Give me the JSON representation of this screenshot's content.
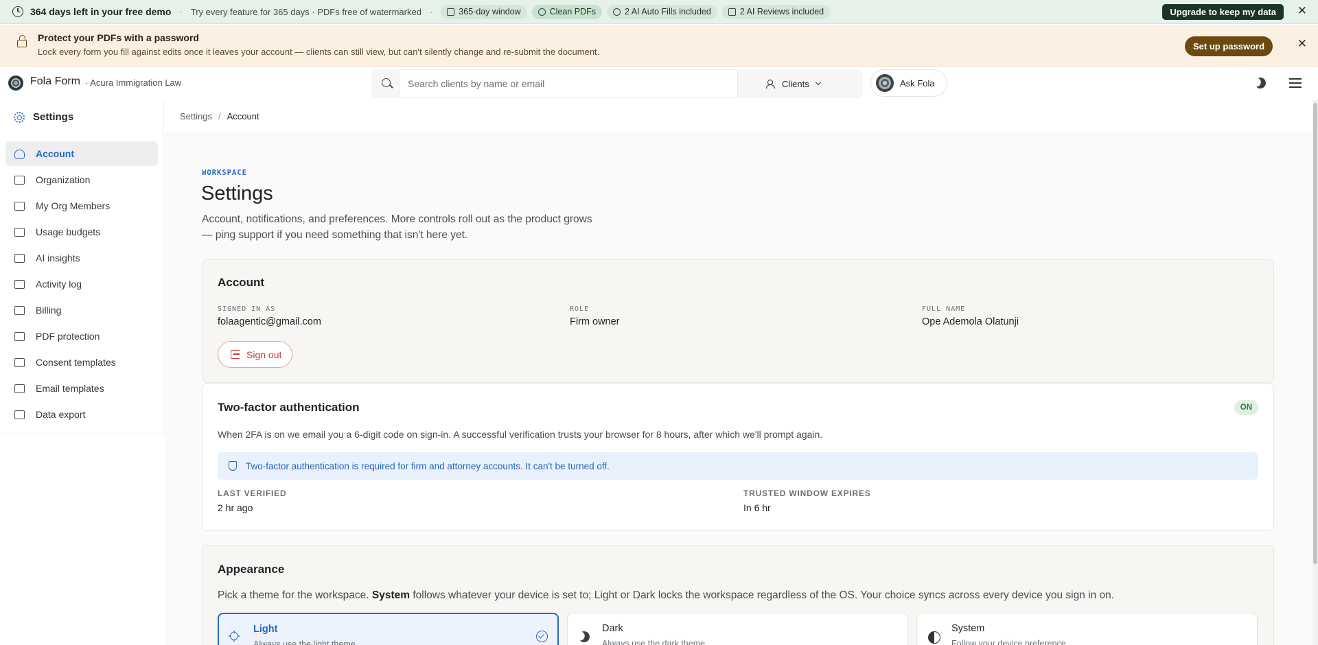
{
  "demo_bar": {
    "title": "364 days left in your free demo",
    "subtitle": "Try every feature for 365 days · PDFs free of watermarked",
    "pills": [
      {
        "label": "365-day window",
        "icon": "calendar-icon"
      },
      {
        "label": "Clean PDFs",
        "icon": "check-circle-icon"
      },
      {
        "label": "2 AI Auto Fills included",
        "icon": "sparkle-icon"
      },
      {
        "label": "2 AI Reviews included",
        "icon": "review-icon"
      }
    ],
    "upgrade_label": "Upgrade to keep my data",
    "close_label": "✕"
  },
  "password_banner": {
    "title": "Protect your PDFs with a password",
    "text": "Lock every form you fill against edits once it leaves your account — clients can still view, but can't silently change and re-submit the document.",
    "button_label": "Set up password",
    "close_label": "✕"
  },
  "header": {
    "brand": "Fola Form",
    "org": "· Acura Immigration Law",
    "search_placeholder": "Search clients by name or email",
    "clients_label": "Clients",
    "ask_label": "Ask Fola"
  },
  "sidebar": {
    "heading": "Settings",
    "items": [
      {
        "label": "Account",
        "icon": "user-icon",
        "active": true
      },
      {
        "label": "Organization",
        "icon": "building-icon"
      },
      {
        "label": "My Org Members",
        "icon": "members-icon"
      },
      {
        "label": "Usage budgets",
        "icon": "sliders-icon"
      },
      {
        "label": "AI insights",
        "icon": "trend-icon"
      },
      {
        "label": "Activity log",
        "icon": "history-icon"
      },
      {
        "label": "Billing",
        "icon": "billing-icon"
      },
      {
        "label": "PDF protection",
        "icon": "lock-icon"
      },
      {
        "label": "Consent templates",
        "icon": "document-icon"
      },
      {
        "label": "Email templates",
        "icon": "mail-icon"
      },
      {
        "label": "Data export",
        "icon": "download-icon"
      }
    ]
  },
  "breadcrumb": {
    "root": "Settings",
    "separator": "/",
    "current": "Account"
  },
  "page": {
    "eyebrow": "WORKSPACE",
    "title": "Settings",
    "description": "Account, notifications, and preferences. More controls roll out as the product grows — ping support if you need something that isn't here yet."
  },
  "account": {
    "title": "Account",
    "signed_in_label": "SIGNED IN AS",
    "signed_in_value": "folaagentic@gmail.com",
    "role_label": "ROLE",
    "role_value": "Firm owner",
    "name_label": "FULL NAME",
    "name_value": "Ope Ademola Olatunji",
    "signout_label": "Sign out"
  },
  "twofa": {
    "title": "Two-factor authentication",
    "status": "ON",
    "description": "When 2FA is on we email you a 6-digit code on sign-in. A successful verification trusts your browser for 8 hours, after which we'll prompt again.",
    "notice": "Two-factor authentication is required for firm and attorney accounts. It can't be turned off.",
    "last_verified_label": "LAST VERIFIED",
    "last_verified_value": "2 hr ago",
    "trusted_label": "TRUSTED WINDOW EXPIRES",
    "trusted_value": "In 6 hr"
  },
  "appearance": {
    "title": "Appearance",
    "desc_before": "Pick a theme for the workspace. ",
    "desc_bold": "System",
    "desc_after": " follows whatever your device is set to; Light or Dark locks the workspace regardless of the OS. Your choice syncs across every device you sign in on.",
    "options": [
      {
        "name": "Light",
        "sub": "Always use the light theme",
        "selected": true
      },
      {
        "name": "Dark",
        "sub": "Always use the dark theme"
      },
      {
        "name": "System",
        "sub": "Follow your device preference"
      }
    ]
  },
  "colors": {
    "accent": "#2467c8",
    "danger": "#c43a3a",
    "demo_bg": "#e6f1ea",
    "banner_bg": "#fbf0e2"
  }
}
